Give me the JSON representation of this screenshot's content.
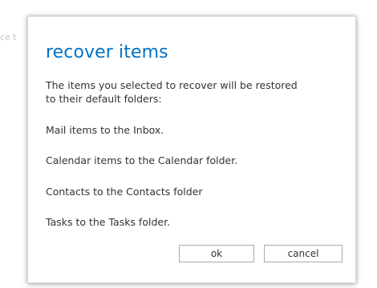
{
  "background": {
    "partial_text": "ce t"
  },
  "dialog": {
    "title": "recover items",
    "intro_line1": "The items you selected to recover will be restored",
    "intro_line2": "to their default folders:",
    "lines": [
      "Mail items to the Inbox.",
      "Calendar items to the Calendar folder.",
      "Contacts to the Contacts folder",
      "Tasks to the Tasks folder."
    ],
    "buttons": {
      "ok": "ok",
      "cancel": "cancel"
    }
  },
  "colors": {
    "title": "#0072c6",
    "text": "#333333",
    "button_border": "#aaaaaa"
  }
}
